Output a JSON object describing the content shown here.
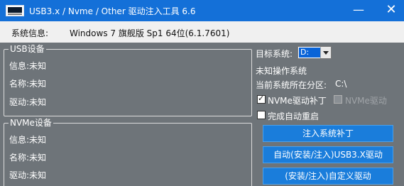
{
  "window": {
    "title": "USB3.x / Nvme / Other 驱动注入工具 6.6",
    "minimize_glyph": "—",
    "close_glyph": "✕"
  },
  "system": {
    "label": "系统信息:",
    "value": "Windows 7 旗舰版 Sp1 64位(6.1.7601)"
  },
  "usb_group": {
    "legend": "USB设备",
    "rows": [
      "信息:未知",
      "名称:未知",
      "驱动:未知"
    ]
  },
  "nvme_group": {
    "legend": "NVMe设备",
    "rows": [
      "信息:未知",
      "名称:未知",
      "驱动:未知"
    ]
  },
  "target": {
    "label": "目标系统:",
    "selected": "D:",
    "os_status": "未知操作系统",
    "partition_label": "当前系统所在分区:",
    "partition_value": "C:\\"
  },
  "options": {
    "nvme_patch": {
      "label": "NVMe驱动补丁",
      "checked": true
    },
    "nvme_driver": {
      "label": "NVMe驱动",
      "checked": false,
      "enabled": false
    },
    "auto_restart": {
      "label": "完成自动重启",
      "checked": false
    }
  },
  "buttons": {
    "inject_patch": "注入系统补丁",
    "auto_usb": "自动(安装/注入)USB3.X驱动",
    "custom_driver": "(安装/注入)自定义驱动"
  },
  "colors": {
    "titlebar": "#1470d8",
    "panel": "#6e7479",
    "button": "#1a7ddb",
    "sysbar": "#f0f0f0"
  }
}
